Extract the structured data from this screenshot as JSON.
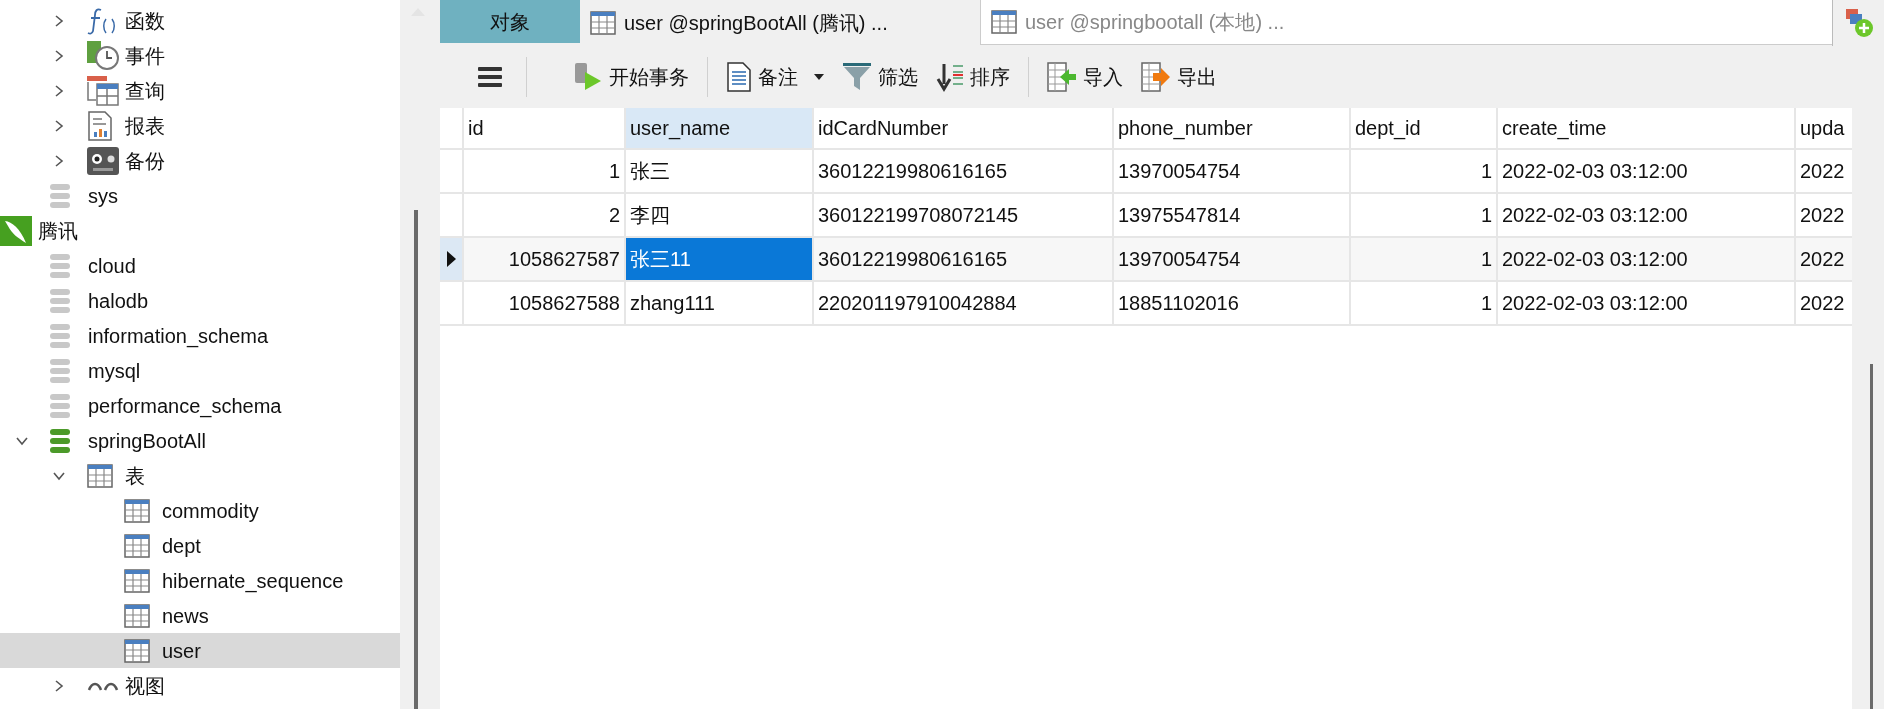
{
  "sidebar": {
    "tree": [
      {
        "children": [
          {
            "children": [
              {
                "kind": "function",
                "label": "函数",
                "expanded": false,
                "selected": false
              },
              {
                "kind": "event",
                "label": "事件",
                "expanded": false,
                "selected": false
              },
              {
                "kind": "query",
                "label": "查询",
                "expanded": false,
                "selected": false
              },
              {
                "kind": "report",
                "label": "报表",
                "expanded": false,
                "selected": false
              },
              {
                "kind": "backup",
                "label": "备份",
                "expanded": false,
                "selected": false
              }
            ]
          },
          {
            "kind": "database",
            "label": "sys",
            "open": false,
            "selected": false
          }
        ]
      },
      {
        "kind": "connection",
        "label": "腾讯",
        "selected": false,
        "children": [
          {
            "kind": "database",
            "label": "cloud",
            "open": false,
            "selected": false
          },
          {
            "kind": "database",
            "label": "halodb",
            "open": false,
            "selected": false
          },
          {
            "kind": "database",
            "label": "information_schema",
            "open": false,
            "selected": false
          },
          {
            "kind": "database",
            "label": "mysql",
            "open": false,
            "selected": false
          },
          {
            "kind": "database",
            "label": "performance_schema",
            "open": false,
            "selected": false
          },
          {
            "kind": "database",
            "label": "springBootAll",
            "open": true,
            "expanded": true,
            "selected": false,
            "children": [
              {
                "kind": "tables",
                "label": "表",
                "expanded": true,
                "selected": false,
                "children": [
                  {
                    "kind": "table",
                    "label": "commodity",
                    "selected": false
                  },
                  {
                    "kind": "table",
                    "label": "dept",
                    "selected": false
                  },
                  {
                    "kind": "table",
                    "label": "hibernate_sequence",
                    "selected": false
                  },
                  {
                    "kind": "table",
                    "label": "news",
                    "selected": false
                  },
                  {
                    "kind": "table",
                    "label": "user",
                    "selected": true
                  }
                ]
              },
              {
                "kind": "view",
                "label": "视图",
                "expanded": false,
                "selected": false
              }
            ]
          }
        ]
      }
    ]
  },
  "tabs": [
    {
      "kind": "objects",
      "label": "对象",
      "selected": false
    },
    {
      "kind": "table",
      "label": "user @springBootAll (腾讯) ...",
      "selected": true
    },
    {
      "kind": "table",
      "label": "user @springbootall (本地) ...",
      "selected": false
    }
  ],
  "toolbar": {
    "groups": [
      [
        {
          "kind": "menu"
        }
      ],
      [
        {
          "kind": "transaction",
          "label": "开始事务",
          "has_menu": false
        }
      ],
      [
        {
          "kind": "memo",
          "label": "备注",
          "has_menu": true
        },
        {
          "kind": "filter",
          "label": "筛选",
          "has_menu": false
        },
        {
          "kind": "sort",
          "label": "排序",
          "has_menu": false
        }
      ],
      [
        {
          "kind": "import",
          "label": "导入",
          "has_menu": false
        },
        {
          "kind": "export",
          "label": "导出",
          "has_menu": false
        }
      ]
    ]
  },
  "grid": {
    "columns": [
      {
        "label": "id",
        "kind": "number",
        "selected": false
      },
      {
        "label": "user_name",
        "kind": "text",
        "selected": true
      },
      {
        "label": "idCardNumber",
        "kind": "text",
        "selected": false
      },
      {
        "label": "phone_number",
        "kind": "text",
        "selected": false
      },
      {
        "label": "dept_id",
        "kind": "number",
        "selected": false
      },
      {
        "label": "create_time",
        "kind": "text",
        "selected": false
      },
      {
        "label": "upda",
        "kind": "text",
        "selected": false
      }
    ],
    "rows": [
      {
        "current": false,
        "cells": [
          {
            "value": "1",
            "selected": false
          },
          {
            "value": "张三",
            "selected": false
          },
          {
            "value": "36012219980616165",
            "selected": false
          },
          {
            "value": "13970054754",
            "selected": false
          },
          {
            "value": "1",
            "selected": false
          },
          {
            "value": "2022-02-03 03:12:00",
            "selected": false
          },
          {
            "value": "2022",
            "selected": false
          }
        ]
      },
      {
        "current": false,
        "cells": [
          {
            "value": "2",
            "selected": false
          },
          {
            "value": "李四",
            "selected": false
          },
          {
            "value": "360122199708072145",
            "selected": false
          },
          {
            "value": "13975547814",
            "selected": false
          },
          {
            "value": "1",
            "selected": false
          },
          {
            "value": "2022-02-03 03:12:00",
            "selected": false
          },
          {
            "value": "2022",
            "selected": false
          }
        ]
      },
      {
        "current": true,
        "cells": [
          {
            "value": "1058627587",
            "selected": false
          },
          {
            "value": "张三11",
            "selected": true
          },
          {
            "value": "36012219980616165",
            "selected": false
          },
          {
            "value": "13970054754",
            "selected": false
          },
          {
            "value": "1",
            "selected": false
          },
          {
            "value": "2022-02-03 03:12:00",
            "selected": false
          },
          {
            "value": "2022",
            "selected": false
          }
        ]
      },
      {
        "current": false,
        "cells": [
          {
            "value": "1058627588",
            "selected": false
          },
          {
            "value": "zhang111",
            "selected": false
          },
          {
            "value": "220201197910042884",
            "selected": false
          },
          {
            "value": "18851102016",
            "selected": false
          },
          {
            "value": "1",
            "selected": false
          },
          {
            "value": "2022-02-03 03:12:00",
            "selected": false
          },
          {
            "value": "2022",
            "selected": false
          }
        ]
      }
    ]
  }
}
